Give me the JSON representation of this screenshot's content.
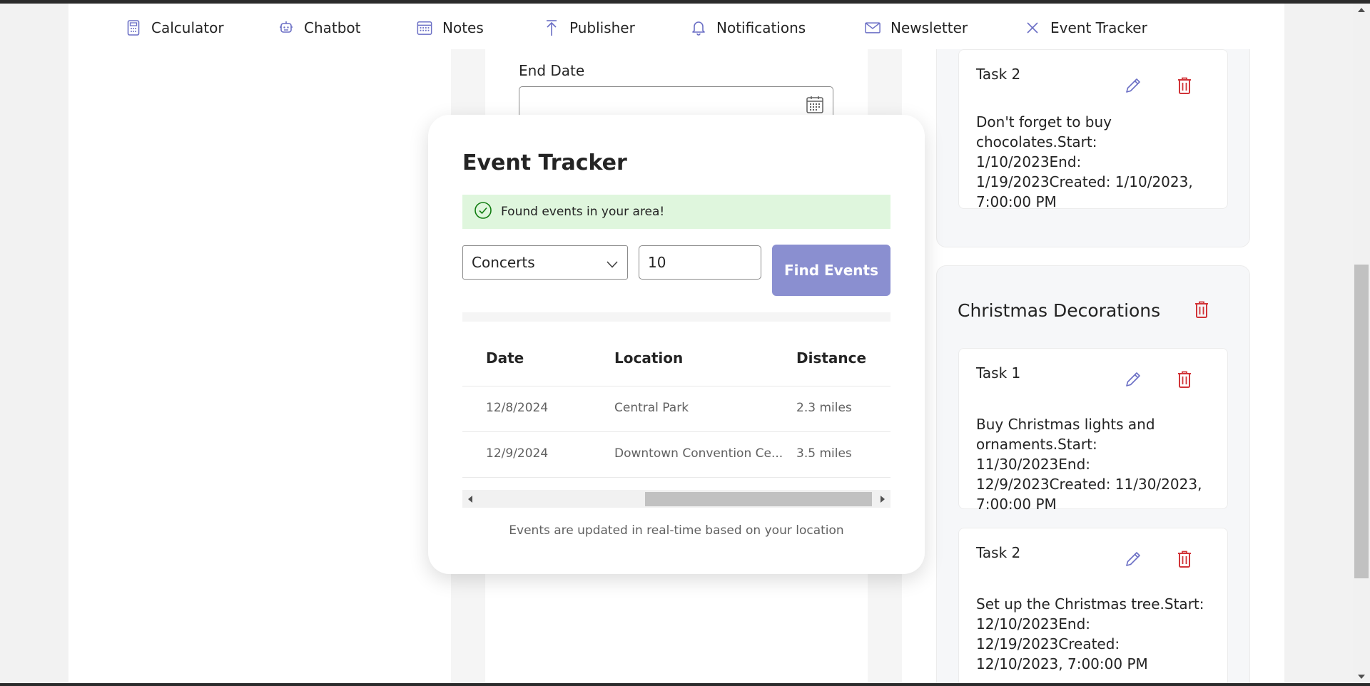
{
  "nav": {
    "items": [
      {
        "label": "Calculator",
        "icon": "calculator-icon"
      },
      {
        "label": "Chatbot",
        "icon": "bot-icon"
      },
      {
        "label": "Notes",
        "icon": "calendar-icon"
      },
      {
        "label": "Publisher",
        "icon": "upload-arrow-icon"
      },
      {
        "label": "Notifications",
        "icon": "bell-icon"
      },
      {
        "label": "Newsletter",
        "icon": "mail-icon"
      },
      {
        "label": "Event Tracker",
        "icon": "close-icon"
      }
    ]
  },
  "form": {
    "end_date_label": "End Date",
    "end_date_value": ""
  },
  "groups": [
    {
      "title": "",
      "tasks": [
        {
          "title": "Task 2",
          "body": "Don't forget to buy chocolates.Start: 1/10/2023End: 1/19/2023Created: 1/10/2023, 7:00:00 PM"
        }
      ]
    },
    {
      "title": "Christmas Decorations",
      "tasks": [
        {
          "title": "Task 1",
          "body": "Buy Christmas lights and ornaments.Start: 11/30/2023End: 12/9/2023Created: 11/30/2023, 7:00:00 PM"
        },
        {
          "title": "Task 2",
          "body": "Set up the Christmas tree.Start: 12/10/2023End: 12/19/2023Created: 12/10/2023, 7:00:00 PM"
        }
      ]
    }
  ],
  "modal": {
    "title": "Event Tracker",
    "alert": "Found events in your area!",
    "category_selected": "Concerts",
    "distance_value": "10",
    "find_button": "Find Events",
    "columns": [
      "Date",
      "Location",
      "Distance"
    ],
    "rows": [
      {
        "date": "12/8/2024",
        "location": "Central Park",
        "distance": "2.3 miles"
      },
      {
        "date": "12/9/2024",
        "location": "Downtown Convention Ce...",
        "distance": "3.5 miles"
      }
    ],
    "footer": "Events are updated in real-time based on your location"
  },
  "colors": {
    "accent": "#6b6fc5",
    "button": "#8a8fd0",
    "success_bg": "#dff6dd",
    "success_icon": "#107c10",
    "danger": "#d13438"
  }
}
